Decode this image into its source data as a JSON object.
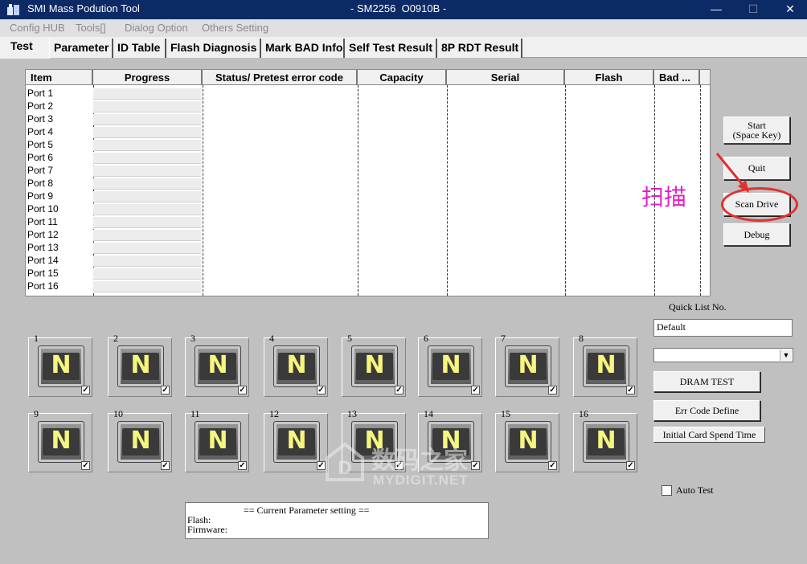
{
  "window": {
    "title_left": "SMI Mass Podution Tool",
    "title_center": "- SM2256  O0910B -",
    "minimize": "—",
    "maximize": "☐",
    "close": "✕"
  },
  "menu": [
    "Config HUB",
    "Tools[]",
    "Dialog Option",
    "Others Setting"
  ],
  "tabs": [
    "Test",
    "Parameter",
    "ID Table",
    "Flash Diagnosis",
    "Mark BAD Info",
    "Self Test Result",
    "8P RDT Result"
  ],
  "table": {
    "headers": [
      "Item",
      "Progress",
      "Status/ Pretest error code",
      "Capacity",
      "Serial",
      "Flash",
      "Bad ..."
    ],
    "ports": [
      "Port 1",
      "Port 2",
      "Port 3",
      "Port 4",
      "Port 5",
      "Port 6",
      "Port 7",
      "Port 8",
      "Port 9",
      "Port 10",
      "Port 11",
      "Port 12",
      "Port 13",
      "Port 14",
      "Port 15",
      "Port 16"
    ]
  },
  "buttons": {
    "start_line1": "Start",
    "start_line2": "(Space Key)",
    "quit": "Quit",
    "scan_drive": "Scan Drive",
    "debug": "Debug",
    "dram_test": "DRAM TEST",
    "err_code_define": "Err Code Define",
    "initial_card_spend_time": "Initial Card Spend Time"
  },
  "annotation": {
    "text": "扫描",
    "color": "#e020c8",
    "ring_color": "#e03030"
  },
  "quick_list": {
    "label": "Quick List No.",
    "value": "Default",
    "combo_value": ""
  },
  "auto_test": {
    "label": "Auto Test",
    "checked": false
  },
  "port_tiles": {
    "letter": "N",
    "numbers": [
      "1",
      "2",
      "3",
      "4",
      "5",
      "6",
      "7",
      "8",
      "9",
      "10",
      "11",
      "12",
      "13",
      "14",
      "15",
      "16"
    ],
    "checkmark": "✓"
  },
  "parameter": {
    "title": "== Current Parameter setting ==",
    "flash_label": "Flash:",
    "firmware_label": "Firmware:"
  },
  "watermark": {
    "line1": "数码之家",
    "line2": "MYDIGIT.NET"
  }
}
